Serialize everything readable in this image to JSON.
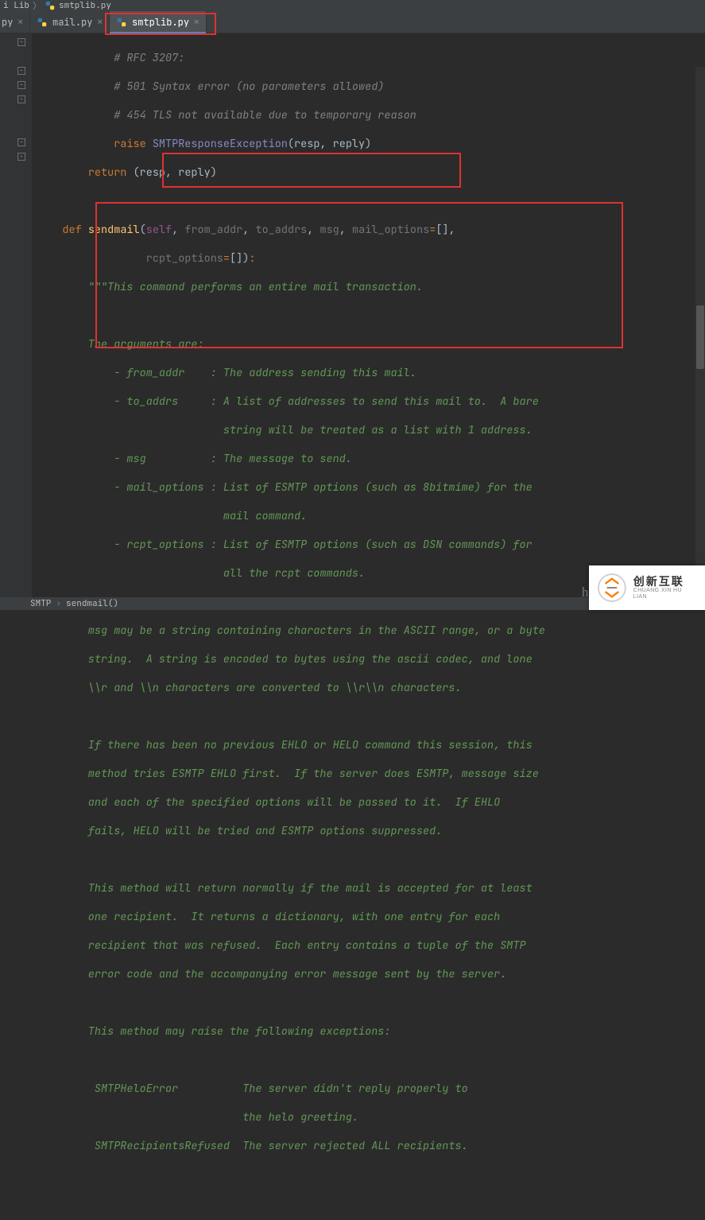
{
  "crumbs": {
    "dir": "i Lib",
    "file": "smtplib.py"
  },
  "tabs": [
    {
      "label": "py",
      "active": false,
      "partial": true
    },
    {
      "label": "mail.py",
      "active": false,
      "partial": false
    },
    {
      "label": "smtplib.py",
      "active": true,
      "partial": false
    }
  ],
  "code": {
    "l1": "            # RFC 3207:",
    "l2": "            # 501 Syntax error (no parameters allowed)",
    "l3": "            # 454 TLS not available due to temporary reason",
    "l4a": "            ",
    "l4b": "raise",
    "l4c": " ",
    "l4d": "SMTPResponseException",
    "l4e": "(resp, reply)",
    "l5a": "        ",
    "l5b": "return",
    "l5c": " (resp, reply)",
    "l6": "",
    "l7a": "    ",
    "l7b": "def",
    "l7c": " ",
    "l7d": "sendmail",
    "l7e": "(",
    "l7f": "self",
    "l7g": ", ",
    "l7h": "from_addr",
    "l7i": ", ",
    "l7j": "to_addrs",
    "l7k": ", ",
    "l7l": "msg",
    "l7m": ", ",
    "l7n": "mail_options",
    "l7o": "=",
    "l7p": "[]",
    "l7q": ",",
    "l8a": "                 ",
    "l8b": "rcpt_options",
    "l8c": "=",
    "l8d": "[]",
    "l8e": ")",
    "l8f": ":",
    "l9": "        \"\"\"This command performs an entire mail transaction.",
    "l10": "",
    "l11": "        The arguments are:",
    "l12": "            - from_addr    : The address sending this mail.",
    "l13": "            - to_addrs     : A list of addresses to send this mail to.  A bare",
    "l14": "                             string will be treated as a list with 1 address.",
    "l15": "            - msg          : The message to send.",
    "l16": "            - mail_options : List of ESMTP options (such as 8bitmime) for the",
    "l17": "                             mail command.",
    "l18": "            - rcpt_options : List of ESMTP options (such as DSN commands) for",
    "l19": "                             all the rcpt commands.",
    "l20": "",
    "l21": "        msg may be a string containing characters in the ASCII range, or a byte",
    "l22": "        string.  A string is encoded to bytes using the ascii codec, and lone",
    "l23": "        \\\\r and \\\\n characters are converted to \\\\r\\\\n characters.",
    "l24": "",
    "l25": "        If there has been no previous EHLO or HELO command this session, this",
    "l26": "        method tries ESMTP EHLO first.  If the server does ESMTP, message size",
    "l27": "        and each of the specified options will be passed to it.  If EHLO",
    "l28": "        fails, HELO will be tried and ESMTP options suppressed.",
    "l29": "",
    "l30": "        This method will return normally if the mail is accepted for at least",
    "l31": "        one recipient.  It returns a dictionary, with one entry for each",
    "l32": "        recipient that was refused.  Each entry contains a tuple of the SMTP",
    "l33": "        error code and the accompanying error message sent by the server.",
    "l34": "",
    "l35": "        This method may raise the following exceptions:",
    "l36": "",
    "l37": "         SMTPHeloError          The server didn't reply properly to",
    "l38": "                                the helo greeting.",
    "l39": "         SMTPRecipientsRefused  The server rejected ALL recipients."
  },
  "bottom": {
    "a": "SMTP",
    "b": "sendmail()"
  },
  "watermark": "https://blog.csdn.ne",
  "logo": {
    "cn": "创新互联",
    "en": "CHUANG XIN HU LIAN"
  }
}
